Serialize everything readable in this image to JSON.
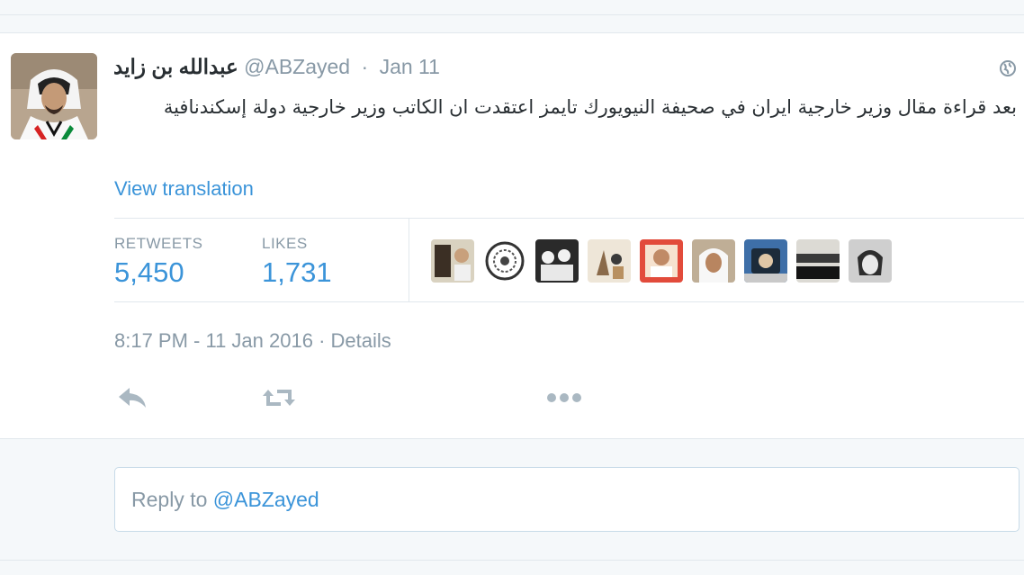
{
  "tweet": {
    "display_name": "عبدالله بن زايد",
    "handle": "@ABZayed",
    "separator": "·",
    "date": "Jan 11",
    "text": "بعد قراءة مقال وزير خارجية ايران في صحيفة النيويورك تايمز اعتقدت ان الكاتب وزير خارجية دولة إسكندنافية",
    "view_translation": "View translation",
    "stats": {
      "retweets_label": "RETWEETS",
      "retweets_value": "5,450",
      "likes_label": "LIKES",
      "likes_value": "1,731"
    },
    "timestamp": "8:17 PM - 11 Jan 2016",
    "details_sep": "·",
    "details_label": "Details",
    "icons": {
      "globe": "globe-icon",
      "reply": "reply-icon",
      "retweet": "retweet-icon",
      "more": "more-icon"
    }
  },
  "reply": {
    "prefix": "Reply to",
    "mention": "@ABZayed"
  },
  "colors": {
    "link": "#3b94d9",
    "muted": "#8899a6",
    "text": "#292f33",
    "background": "#f5f8fa"
  }
}
